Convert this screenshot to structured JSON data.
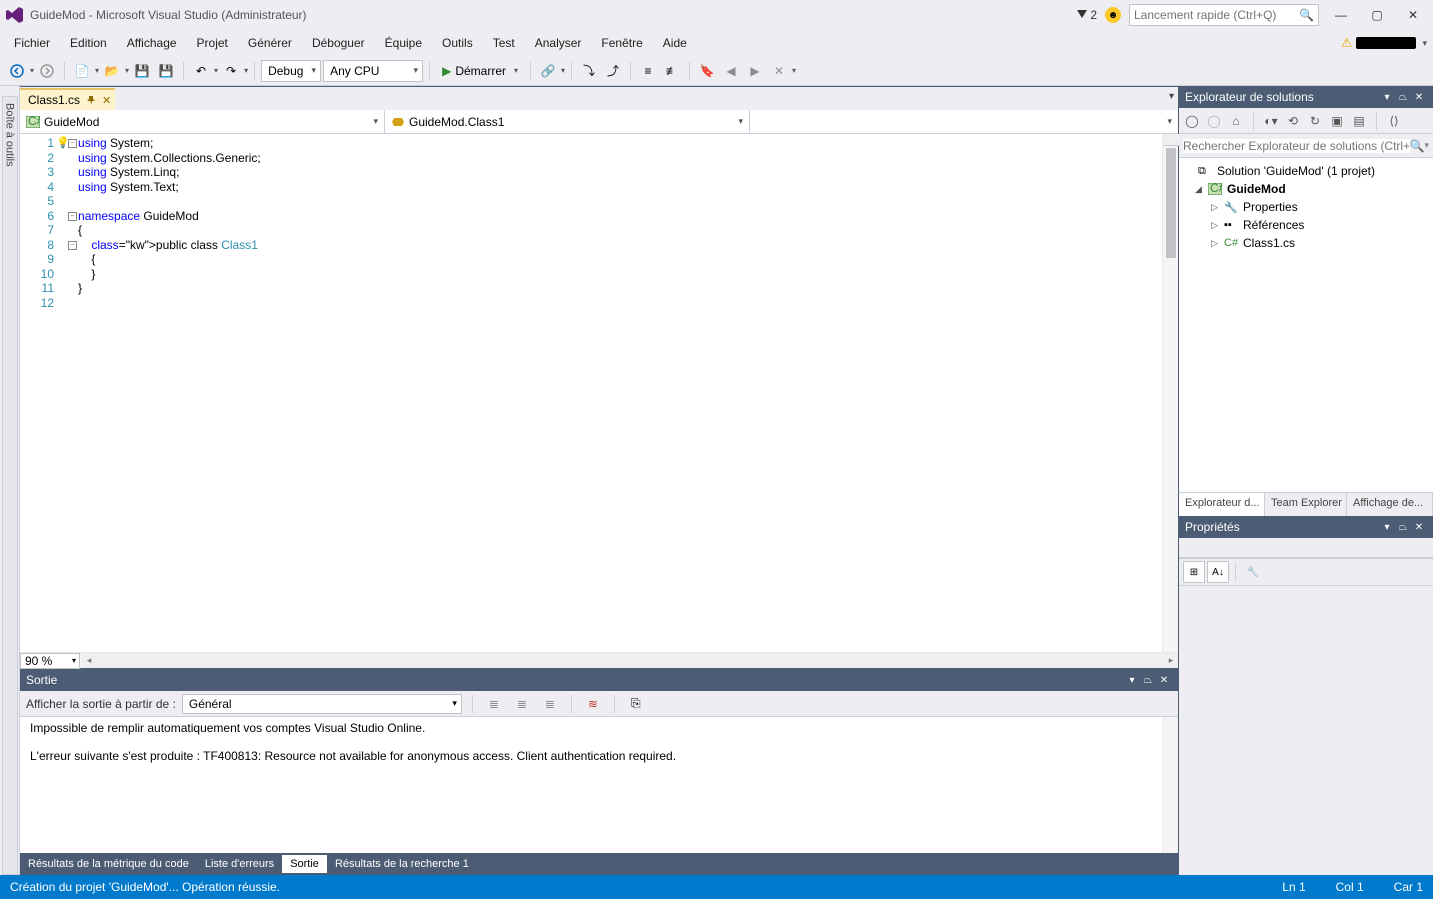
{
  "title": "GuideMod - Microsoft Visual Studio (Administrateur)",
  "notification_count": "2",
  "quick_launch_placeholder": "Lancement rapide (Ctrl+Q)",
  "menu": [
    "Fichier",
    "Edition",
    "Affichage",
    "Projet",
    "Générer",
    "Déboguer",
    "Équipe",
    "Outils",
    "Test",
    "Analyser",
    "Fenêtre",
    "Aide"
  ],
  "toolbar": {
    "config": "Debug",
    "platform": "Any CPU",
    "start_label": "Démarrer"
  },
  "doc_tab": {
    "name": "Class1.cs"
  },
  "nav": {
    "scope": "GuideMod",
    "type": "GuideMod.Class1",
    "member": ""
  },
  "code_lines": [
    {
      "n": "1",
      "t": "using System;",
      "kw": [
        "using"
      ]
    },
    {
      "n": "2",
      "t": "using System.Collections.Generic;",
      "kw": [
        "using"
      ]
    },
    {
      "n": "3",
      "t": "using System.Linq;",
      "kw": [
        "using"
      ]
    },
    {
      "n": "4",
      "t": "using System.Text;",
      "kw": [
        "using"
      ]
    },
    {
      "n": "5",
      "t": ""
    },
    {
      "n": "6",
      "t": "namespace GuideMod",
      "kw": [
        "namespace"
      ]
    },
    {
      "n": "7",
      "t": "{"
    },
    {
      "n": "8",
      "t": "    public class Class1",
      "kw": [
        "public",
        "class"
      ],
      "typ": [
        "Class1"
      ]
    },
    {
      "n": "9",
      "t": "    {"
    },
    {
      "n": "10",
      "t": "    }"
    },
    {
      "n": "11",
      "t": "}"
    },
    {
      "n": "12",
      "t": ""
    }
  ],
  "zoom": "90 %",
  "output": {
    "title": "Sortie",
    "show_from_label": "Afficher la sortie à partir de :",
    "source": "Général",
    "text": "Impossible de remplir automatiquement vos comptes Visual Studio Online.\n\nL'erreur suivante s'est produite : TF400813: Resource not available for anonymous access. Client authentication required."
  },
  "bottom_tabs": [
    "Résultats de la métrique du code",
    "Liste d'erreurs",
    "Sortie",
    "Résultats de la recherche 1"
  ],
  "statusbar": {
    "message": "Création du projet 'GuideMod'... Opération réussie.",
    "line": "Ln 1",
    "col": "Col 1",
    "char": "Car 1"
  },
  "solution_explorer": {
    "title": "Explorateur de solutions",
    "search_placeholder": "Rechercher Explorateur de solutions (Ctrl+",
    "solution_label": "Solution 'GuideMod' (1 projet)",
    "project": "GuideMod",
    "nodes": [
      "Properties",
      "Références",
      "Class1.cs"
    ],
    "tabs": [
      "Explorateur d...",
      "Team Explorer",
      "Affichage de..."
    ]
  },
  "properties": {
    "title": "Propriétés"
  }
}
